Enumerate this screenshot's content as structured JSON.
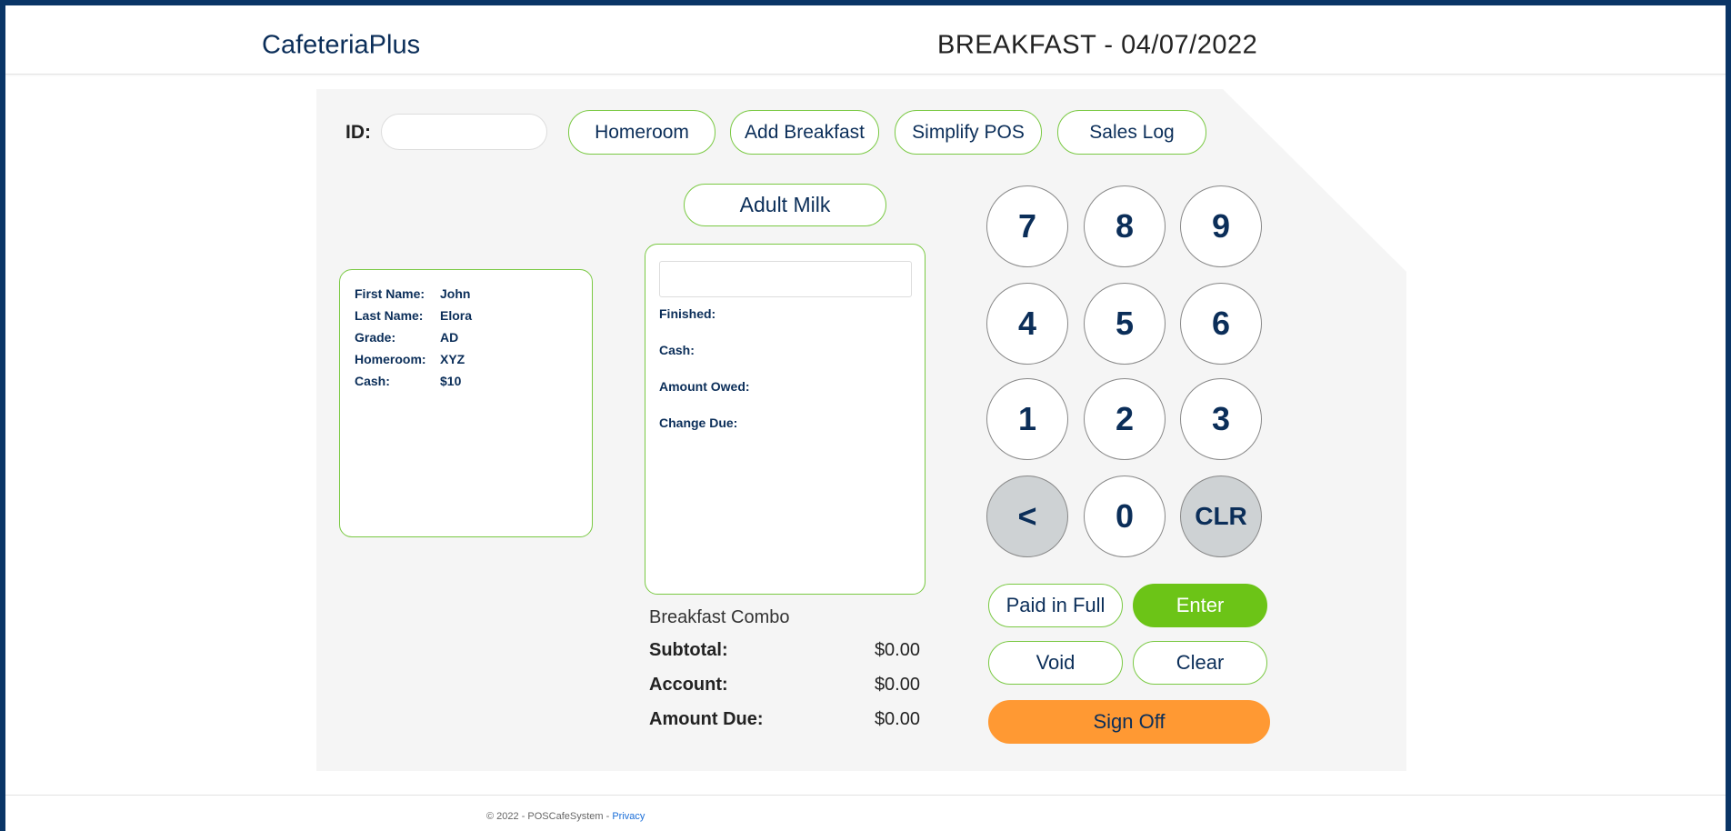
{
  "header": {
    "brand": "CafeteriaPlus",
    "title": "BREAKFAST - 04/07/2022"
  },
  "toolbar": {
    "id_label": "ID:",
    "id_value": "",
    "buttons": [
      "Homeroom",
      "Add Breakfast",
      "Simplify POS",
      "Sales Log"
    ]
  },
  "adult_milk": "Adult Milk",
  "student": [
    {
      "label": "First Name:",
      "value": "John"
    },
    {
      "label": "Last Name:",
      "value": "Elora"
    },
    {
      "label": "Grade:",
      "value": "AD"
    },
    {
      "label": "Homeroom:",
      "value": "XYZ"
    },
    {
      "label": "Cash:",
      "value": "$10"
    }
  ],
  "transaction": {
    "input_value": "",
    "labels": [
      "Finished:",
      "Cash:",
      "Amount Owed:",
      "Change Due:"
    ]
  },
  "order": {
    "item": "Breakfast Combo",
    "totals": [
      {
        "label": "Subtotal:",
        "value": "$0.00"
      },
      {
        "label": "Account:",
        "value": "$0.00"
      },
      {
        "label": "Amount Due:",
        "value": "$0.00"
      }
    ]
  },
  "keypad": [
    "7",
    "8",
    "9",
    "4",
    "5",
    "6",
    "1",
    "2",
    "3",
    "<",
    "0",
    "CLR"
  ],
  "actions": {
    "paid_in_full": "Paid in Full",
    "enter": "Enter",
    "void": "Void",
    "clear": "Clear",
    "sign_off": "Sign Off"
  },
  "footer": {
    "copyright": "© 2022 - POSCafeSystem - ",
    "privacy": "Privacy"
  },
  "colors": {
    "navy": "#0b2e59",
    "green": "#6cc417",
    "orange": "#ff9933",
    "frame": "#0a3566"
  }
}
